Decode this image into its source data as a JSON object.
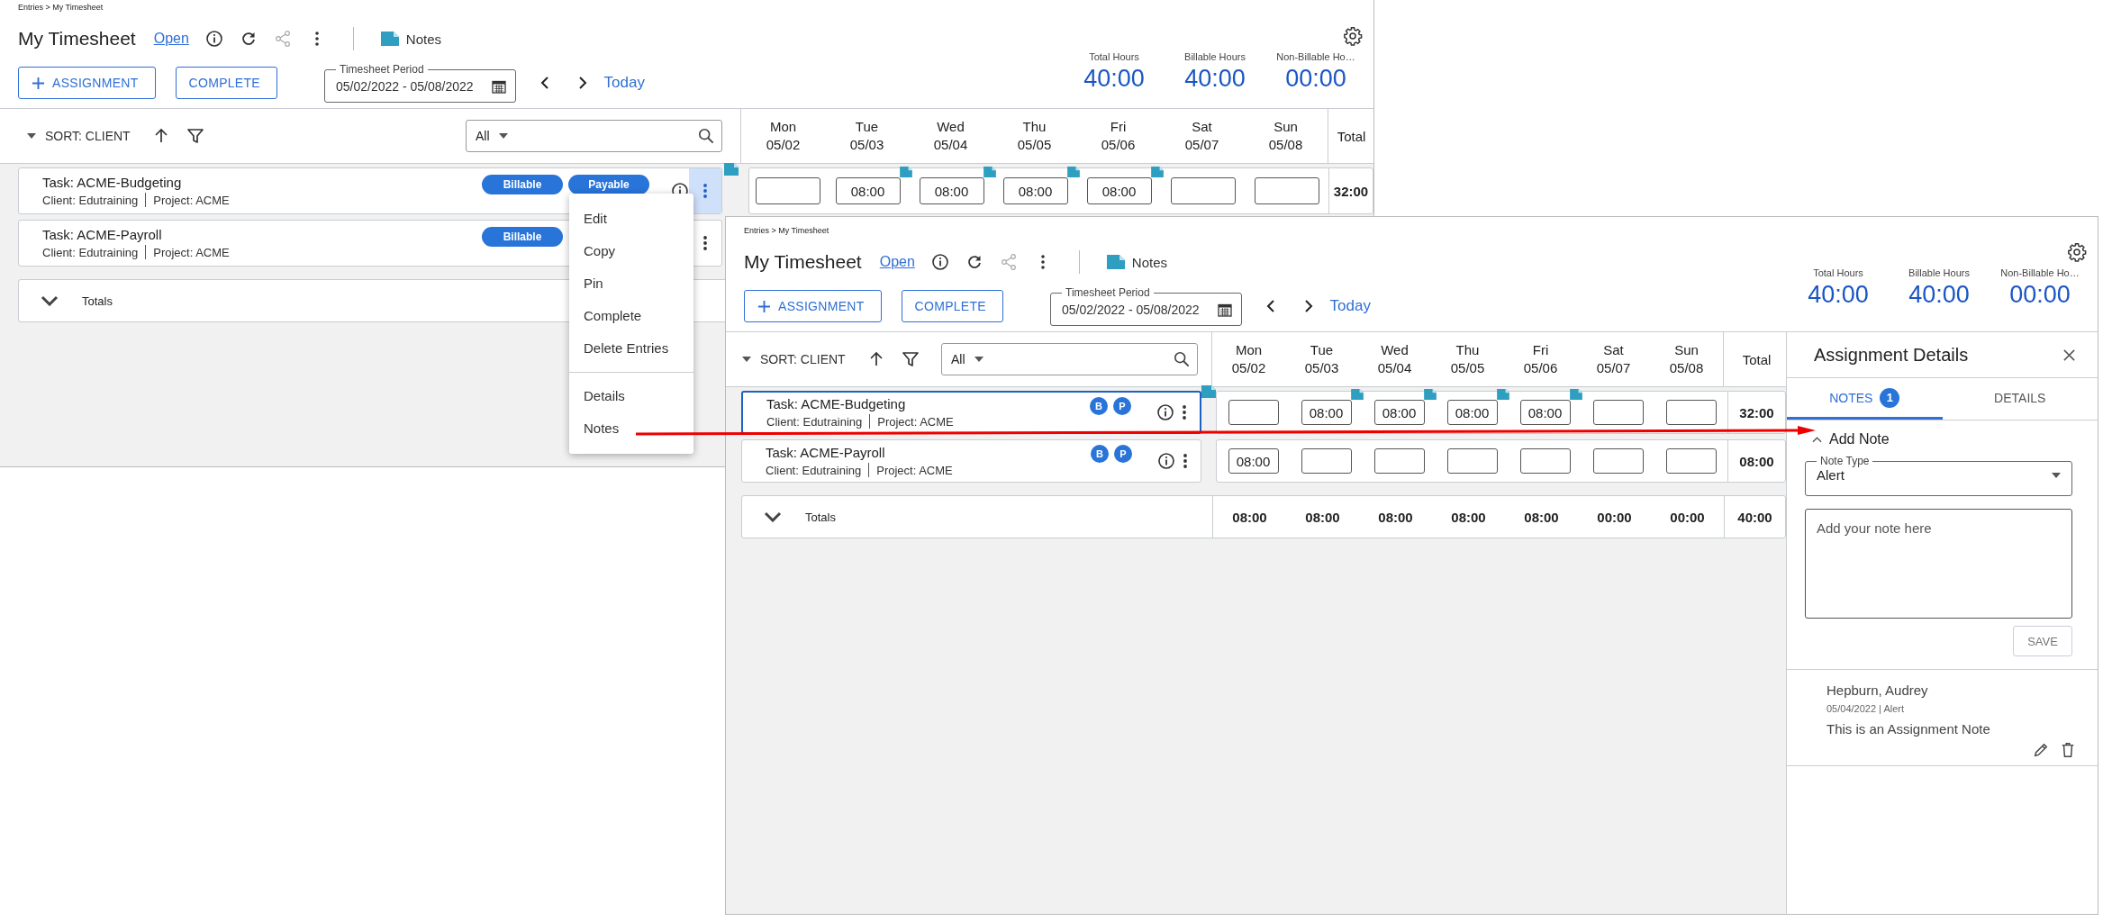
{
  "windows": [
    {
      "breadcrumb": "Entries > My Timesheet",
      "title": "My Timesheet",
      "status": "Open",
      "notes_label": "Notes",
      "add_button": "ASSIGNMENT",
      "complete_button": "COMPLETE",
      "period": {
        "label": "Timesheet Period",
        "value": "05/02/2022 - 05/08/2022"
      },
      "today": "Today",
      "summary": [
        {
          "label": "Total Hours",
          "value": "40:00"
        },
        {
          "label": "Billable Hours",
          "value": "40:00"
        },
        {
          "label": "Non-Billable Ho…",
          "value": "00:00"
        }
      ],
      "sort": "SORT: CLIENT",
      "filter": {
        "value": "All"
      },
      "days": [
        {
          "day": "Mon",
          "date": "05/02"
        },
        {
          "day": "Tue",
          "date": "05/03"
        },
        {
          "day": "Wed",
          "date": "05/04"
        },
        {
          "day": "Thu",
          "date": "05/05"
        },
        {
          "day": "Fri",
          "date": "05/06"
        },
        {
          "day": "Sat",
          "date": "05/07"
        },
        {
          "day": "Sun",
          "date": "05/08"
        }
      ],
      "total_heading": "Total",
      "rows": [
        {
          "task": "Task: ACME-Budgeting",
          "client": "Client: Edutraining",
          "project": "Project: ACME",
          "badges": [
            {
              "label": "Billable",
              "kind": "pill"
            },
            {
              "label": "Payable",
              "kind": "pill"
            }
          ],
          "selected": false,
          "menu_open": true,
          "note": true,
          "hours": [
            {
              "note": false
            },
            {
              "value": "08:00",
              "note": true
            },
            {
              "value": "08:00",
              "note": true
            },
            {
              "value": "08:00",
              "note": true
            },
            {
              "value": "08:00",
              "note": true
            },
            {
              "note": false
            },
            {
              "note": false
            }
          ],
          "total": "32:00"
        },
        {
          "task": "Task: ACME-Payroll",
          "client": "Client: Edutraining",
          "project": "Project: ACME",
          "badges": [
            {
              "label": "Billable",
              "kind": "pill"
            }
          ],
          "selected": false,
          "menu_open": false,
          "note": false
        }
      ],
      "totals": {
        "label": "Totals"
      },
      "menu": {
        "sections": [
          [
            "Edit",
            "Copy",
            "Pin",
            "Complete",
            "Delete Entries"
          ],
          [
            "Details",
            "Notes"
          ]
        ]
      }
    },
    {
      "breadcrumb": "Entries > My Timesheet",
      "title": "My Timesheet",
      "status": "Open",
      "notes_label": "Notes",
      "add_button": "ASSIGNMENT",
      "complete_button": "COMPLETE",
      "period": {
        "label": "Timesheet Period",
        "value": "05/02/2022 - 05/08/2022"
      },
      "today": "Today",
      "summary": [
        {
          "label": "Total Hours",
          "value": "40:00"
        },
        {
          "label": "Billable Hours",
          "value": "40:00"
        },
        {
          "label": "Non-Billable Ho…",
          "value": "00:00"
        }
      ],
      "sort": "SORT: CLIENT",
      "filter": {
        "value": "All"
      },
      "days": [
        {
          "day": "Mon",
          "date": "05/02"
        },
        {
          "day": "Tue",
          "date": "05/03"
        },
        {
          "day": "Wed",
          "date": "05/04"
        },
        {
          "day": "Thu",
          "date": "05/05"
        },
        {
          "day": "Fri",
          "date": "05/06"
        },
        {
          "day": "Sat",
          "date": "05/07"
        },
        {
          "day": "Sun",
          "date": "05/08"
        }
      ],
      "total_heading": "Total",
      "rows": [
        {
          "task": "Task: ACME-Budgeting",
          "client": "Client: Edutraining",
          "project": "Project: ACME",
          "badges": [
            {
              "label": "B",
              "kind": "circle"
            },
            {
              "label": "P",
              "kind": "circle"
            }
          ],
          "selected": true,
          "menu_open": false,
          "note": true,
          "hours": [
            {
              "note": false
            },
            {
              "value": "08:00",
              "note": true
            },
            {
              "value": "08:00",
              "note": true
            },
            {
              "value": "08:00",
              "note": true
            },
            {
              "value": "08:00",
              "note": true
            },
            {
              "note": false
            },
            {
              "note": false
            }
          ],
          "total": "32:00"
        },
        {
          "task": "Task: ACME-Payroll",
          "client": "Client: Edutraining",
          "project": "Project: ACME",
          "badges": [
            {
              "label": "B",
              "kind": "circle"
            },
            {
              "label": "P",
              "kind": "circle"
            }
          ],
          "selected": false,
          "menu_open": false,
          "note": false,
          "hours": [
            {
              "value": "08:00",
              "note": false
            },
            {
              "note": false
            },
            {
              "note": false
            },
            {
              "note": false
            },
            {
              "note": false
            },
            {
              "note": false
            },
            {
              "note": false
            }
          ],
          "total": "08:00"
        }
      ],
      "totals": {
        "label": "Totals",
        "values": [
          "08:00",
          "08:00",
          "08:00",
          "08:00",
          "08:00",
          "00:00",
          "00:00"
        ],
        "total": "40:00"
      },
      "panel": {
        "title": "Assignment Details",
        "tabs": [
          {
            "label": "NOTES",
            "count": "1",
            "selected": true
          },
          {
            "label": "DETAILS",
            "selected": false
          }
        ],
        "add_note": {
          "label": "Add Note",
          "expanded": true
        },
        "note_type": {
          "label": "Note Type",
          "value": "Alert"
        },
        "note_field": {
          "placeholder": "Add your note here"
        },
        "save": {
          "label": "SAVE",
          "disabled": true
        },
        "notes": [
          {
            "author": "Hepburn, Audrey",
            "meta": "05/04/2022 | Alert",
            "text": "This is an Assignment Note"
          }
        ]
      }
    }
  ]
}
